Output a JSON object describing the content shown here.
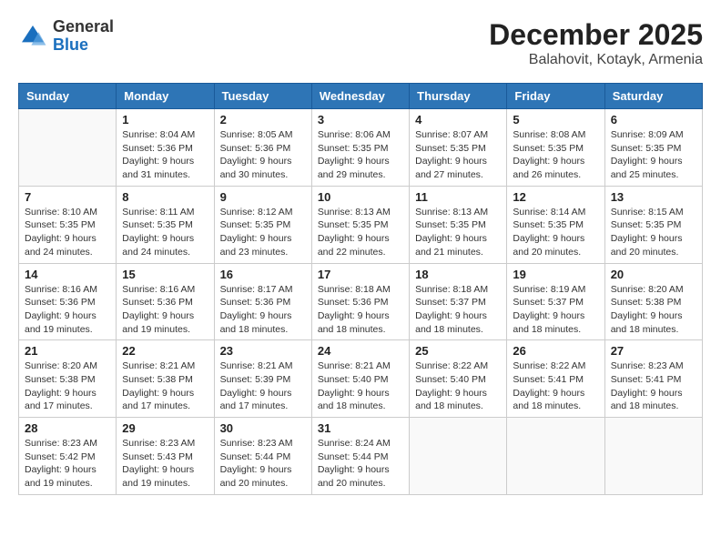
{
  "logo": {
    "general": "General",
    "blue": "Blue"
  },
  "title": "December 2025",
  "subtitle": "Balahovit, Kotayk, Armenia",
  "days_of_week": [
    "Sunday",
    "Monday",
    "Tuesday",
    "Wednesday",
    "Thursday",
    "Friday",
    "Saturday"
  ],
  "weeks": [
    [
      {
        "day": "",
        "sunrise": "",
        "sunset": "",
        "daylight": ""
      },
      {
        "day": "1",
        "sunrise": "Sunrise: 8:04 AM",
        "sunset": "Sunset: 5:36 PM",
        "daylight": "Daylight: 9 hours and 31 minutes."
      },
      {
        "day": "2",
        "sunrise": "Sunrise: 8:05 AM",
        "sunset": "Sunset: 5:36 PM",
        "daylight": "Daylight: 9 hours and 30 minutes."
      },
      {
        "day": "3",
        "sunrise": "Sunrise: 8:06 AM",
        "sunset": "Sunset: 5:35 PM",
        "daylight": "Daylight: 9 hours and 29 minutes."
      },
      {
        "day": "4",
        "sunrise": "Sunrise: 8:07 AM",
        "sunset": "Sunset: 5:35 PM",
        "daylight": "Daylight: 9 hours and 27 minutes."
      },
      {
        "day": "5",
        "sunrise": "Sunrise: 8:08 AM",
        "sunset": "Sunset: 5:35 PM",
        "daylight": "Daylight: 9 hours and 26 minutes."
      },
      {
        "day": "6",
        "sunrise": "Sunrise: 8:09 AM",
        "sunset": "Sunset: 5:35 PM",
        "daylight": "Daylight: 9 hours and 25 minutes."
      }
    ],
    [
      {
        "day": "7",
        "sunrise": "Sunrise: 8:10 AM",
        "sunset": "Sunset: 5:35 PM",
        "daylight": "Daylight: 9 hours and 24 minutes."
      },
      {
        "day": "8",
        "sunrise": "Sunrise: 8:11 AM",
        "sunset": "Sunset: 5:35 PM",
        "daylight": "Daylight: 9 hours and 24 minutes."
      },
      {
        "day": "9",
        "sunrise": "Sunrise: 8:12 AM",
        "sunset": "Sunset: 5:35 PM",
        "daylight": "Daylight: 9 hours and 23 minutes."
      },
      {
        "day": "10",
        "sunrise": "Sunrise: 8:13 AM",
        "sunset": "Sunset: 5:35 PM",
        "daylight": "Daylight: 9 hours and 22 minutes."
      },
      {
        "day": "11",
        "sunrise": "Sunrise: 8:13 AM",
        "sunset": "Sunset: 5:35 PM",
        "daylight": "Daylight: 9 hours and 21 minutes."
      },
      {
        "day": "12",
        "sunrise": "Sunrise: 8:14 AM",
        "sunset": "Sunset: 5:35 PM",
        "daylight": "Daylight: 9 hours and 20 minutes."
      },
      {
        "day": "13",
        "sunrise": "Sunrise: 8:15 AM",
        "sunset": "Sunset: 5:35 PM",
        "daylight": "Daylight: 9 hours and 20 minutes."
      }
    ],
    [
      {
        "day": "14",
        "sunrise": "Sunrise: 8:16 AM",
        "sunset": "Sunset: 5:36 PM",
        "daylight": "Daylight: 9 hours and 19 minutes."
      },
      {
        "day": "15",
        "sunrise": "Sunrise: 8:16 AM",
        "sunset": "Sunset: 5:36 PM",
        "daylight": "Daylight: 9 hours and 19 minutes."
      },
      {
        "day": "16",
        "sunrise": "Sunrise: 8:17 AM",
        "sunset": "Sunset: 5:36 PM",
        "daylight": "Daylight: 9 hours and 18 minutes."
      },
      {
        "day": "17",
        "sunrise": "Sunrise: 8:18 AM",
        "sunset": "Sunset: 5:36 PM",
        "daylight": "Daylight: 9 hours and 18 minutes."
      },
      {
        "day": "18",
        "sunrise": "Sunrise: 8:18 AM",
        "sunset": "Sunset: 5:37 PM",
        "daylight": "Daylight: 9 hours and 18 minutes."
      },
      {
        "day": "19",
        "sunrise": "Sunrise: 8:19 AM",
        "sunset": "Sunset: 5:37 PM",
        "daylight": "Daylight: 9 hours and 18 minutes."
      },
      {
        "day": "20",
        "sunrise": "Sunrise: 8:20 AM",
        "sunset": "Sunset: 5:38 PM",
        "daylight": "Daylight: 9 hours and 18 minutes."
      }
    ],
    [
      {
        "day": "21",
        "sunrise": "Sunrise: 8:20 AM",
        "sunset": "Sunset: 5:38 PM",
        "daylight": "Daylight: 9 hours and 17 minutes."
      },
      {
        "day": "22",
        "sunrise": "Sunrise: 8:21 AM",
        "sunset": "Sunset: 5:38 PM",
        "daylight": "Daylight: 9 hours and 17 minutes."
      },
      {
        "day": "23",
        "sunrise": "Sunrise: 8:21 AM",
        "sunset": "Sunset: 5:39 PM",
        "daylight": "Daylight: 9 hours and 17 minutes."
      },
      {
        "day": "24",
        "sunrise": "Sunrise: 8:21 AM",
        "sunset": "Sunset: 5:40 PM",
        "daylight": "Daylight: 9 hours and 18 minutes."
      },
      {
        "day": "25",
        "sunrise": "Sunrise: 8:22 AM",
        "sunset": "Sunset: 5:40 PM",
        "daylight": "Daylight: 9 hours and 18 minutes."
      },
      {
        "day": "26",
        "sunrise": "Sunrise: 8:22 AM",
        "sunset": "Sunset: 5:41 PM",
        "daylight": "Daylight: 9 hours and 18 minutes."
      },
      {
        "day": "27",
        "sunrise": "Sunrise: 8:23 AM",
        "sunset": "Sunset: 5:41 PM",
        "daylight": "Daylight: 9 hours and 18 minutes."
      }
    ],
    [
      {
        "day": "28",
        "sunrise": "Sunrise: 8:23 AM",
        "sunset": "Sunset: 5:42 PM",
        "daylight": "Daylight: 9 hours and 19 minutes."
      },
      {
        "day": "29",
        "sunrise": "Sunrise: 8:23 AM",
        "sunset": "Sunset: 5:43 PM",
        "daylight": "Daylight: 9 hours and 19 minutes."
      },
      {
        "day": "30",
        "sunrise": "Sunrise: 8:23 AM",
        "sunset": "Sunset: 5:44 PM",
        "daylight": "Daylight: 9 hours and 20 minutes."
      },
      {
        "day": "31",
        "sunrise": "Sunrise: 8:24 AM",
        "sunset": "Sunset: 5:44 PM",
        "daylight": "Daylight: 9 hours and 20 minutes."
      },
      {
        "day": "",
        "sunrise": "",
        "sunset": "",
        "daylight": ""
      },
      {
        "day": "",
        "sunrise": "",
        "sunset": "",
        "daylight": ""
      },
      {
        "day": "",
        "sunrise": "",
        "sunset": "",
        "daylight": ""
      }
    ]
  ]
}
